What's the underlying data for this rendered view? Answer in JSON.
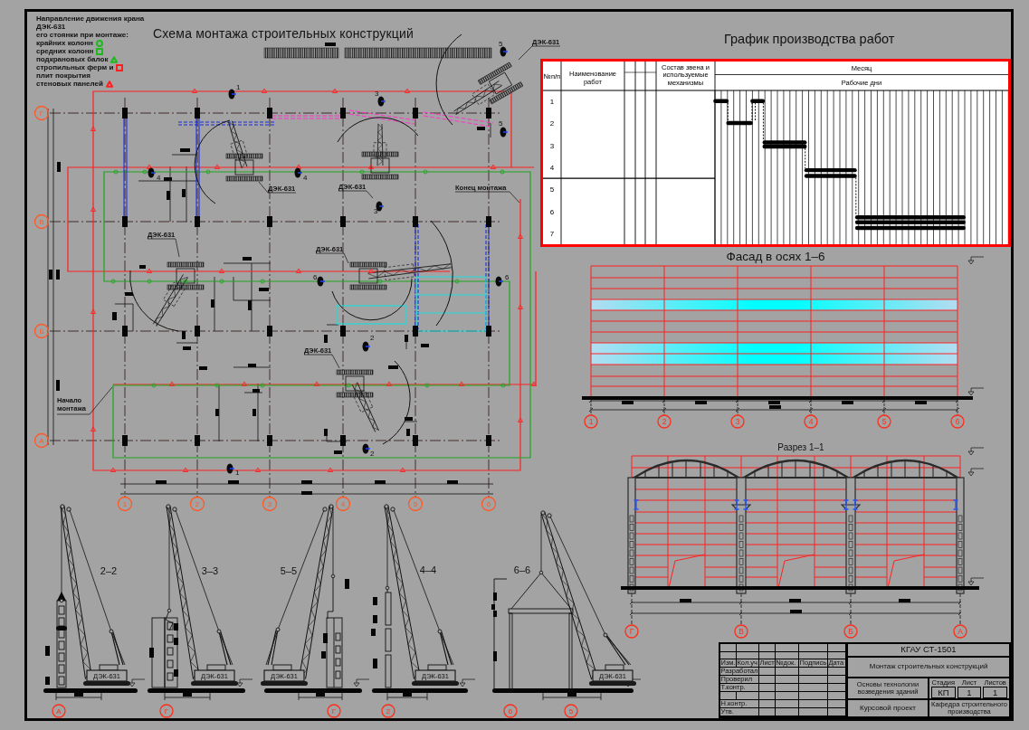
{
  "legend": {
    "heading": "Направление движения крана ДЭК-631\nего стоянки при монтаже:",
    "items": [
      {
        "label": "крайних колонн",
        "kind": "circle",
        "color": "#1fb81f"
      },
      {
        "label": "средних колонн",
        "kind": "square",
        "color": "#1fb81f"
      },
      {
        "label": "подкрановых балок",
        "kind": "triangle",
        "color": "#1fb81f"
      },
      {
        "label": "стропильных ферм и\nплит покрытия",
        "kind": "square",
        "color": "#ff1f1f"
      },
      {
        "label": "стеновых панелей",
        "kind": "triangle",
        "color": "#ff1f1f"
      }
    ]
  },
  "plan": {
    "title": "Схема монтажа строительных конструкций",
    "row_axes": [
      "Г",
      "В",
      "Б",
      "А"
    ],
    "column_axes": [
      "1",
      "2",
      "3",
      "4",
      "5",
      "6"
    ],
    "crane_labels": [
      "ДЭК-631",
      "ДЭК-631",
      "ДЭК-631",
      "ДЭК-631",
      "ДЭК-631",
      "ДЭК-631"
    ],
    "stations": [
      "5",
      "1",
      "3",
      "5",
      "4",
      "4",
      "3",
      "6",
      "6",
      "2",
      "2",
      "1"
    ],
    "notes": [
      {
        "kind": "end",
        "label": "Конец монтажа"
      },
      {
        "kind": "start",
        "label": "Начало монтажа"
      }
    ]
  },
  "crane_sections": [
    {
      "label": "2–2",
      "crane_label": "ДЭК-631",
      "kind": "edge-column",
      "axes": [
        "А"
      ]
    },
    {
      "label": "3–3",
      "crane_label": "ДЭК-631",
      "kind": "wall-panel",
      "axes": [
        "Г"
      ]
    },
    {
      "label": "5–5",
      "crane_label": "ДЭК-631",
      "kind": "middle-column",
      "axes": [
        "Г"
      ]
    },
    {
      "label": "4–4",
      "crane_label": "ДЭК-631",
      "kind": "crane-beam",
      "axes": [
        "2"
      ]
    },
    {
      "label": "6–6",
      "crane_label": "ДЭК-631",
      "kind": "truss",
      "axes": [
        "6",
        "5"
      ]
    }
  ],
  "schedule": {
    "title": "График производства работ",
    "headers": [
      "№п/п",
      "Наименование\nработ",
      "Состав звена и\nиспользуемые\nмеханизмы"
    ],
    "month_header": "Месяц",
    "days_header": "Рабочие дни",
    "row_numbers": [
      "1",
      "2",
      "3",
      "4",
      "5",
      "6",
      "7"
    ]
  },
  "facade": {
    "title": "Фасад в осях 1–6",
    "axes": [
      "1",
      "2",
      "3",
      "4",
      "5",
      "6"
    ]
  },
  "section": {
    "title": "Разрез 1–1",
    "axes": [
      "Г",
      "В",
      "Б",
      "А"
    ]
  },
  "title_block": {
    "code": "КГАУ СТ-1501",
    "drawing_title": "Монтаж строительных конструкций",
    "course": "Основы технологии\nвозведения зданий",
    "stage_headers": [
      "Стадия",
      "Лист",
      "Листов"
    ],
    "stage": "КП",
    "sheet": "1",
    "sheets": "1",
    "document_type": "Курсовой проект",
    "department": "Кафедра строительного\nпроизводства",
    "signature_headers": [
      "Изм.",
      "Кол.уч",
      "Лист",
      "№док.",
      "Подпись",
      "Дата"
    ],
    "roles": [
      "Разработал",
      "Проверил",
      "Т.контр.",
      "Н.контр.",
      "Утв."
    ]
  }
}
